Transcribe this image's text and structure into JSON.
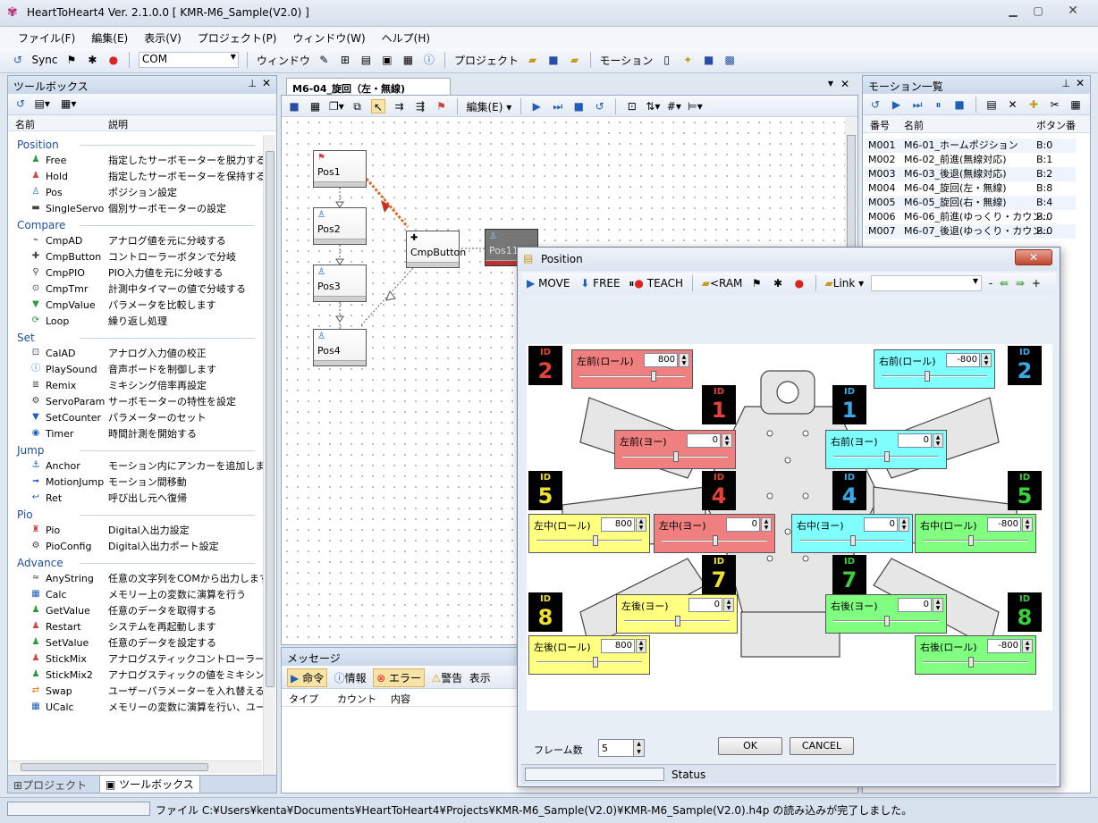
{
  "window": {
    "title": "HeartToHeart4 Ver. 2.1.0.0 [ KMR-M6_Sample(V2.0) ]"
  },
  "menu": [
    "ファイル(F)",
    "編集(E)",
    "表示(V)",
    "プロジェクト(P)",
    "ウィンドウ(W)",
    "ヘルプ(H)"
  ],
  "toolbar": {
    "sync": "Sync",
    "com_label": "COM",
    "window_label": "ウィンドウ",
    "project_label": "プロジェクト",
    "motion_label": "モーション"
  },
  "toolbox": {
    "title": "ツールボックス",
    "col_name": "名前",
    "col_desc": "説明",
    "groups": [
      {
        "name": "Position",
        "items": [
          {
            "icon": "free-icon",
            "name": "Free",
            "desc": "指定したサーボモーターを脱力する"
          },
          {
            "icon": "hold-icon",
            "name": "Hold",
            "desc": "指定したサーボモーターを保持する"
          },
          {
            "icon": "pos-icon",
            "name": "Pos",
            "desc": "ポジション設定"
          },
          {
            "icon": "singleservo-icon",
            "name": "SingleServo",
            "desc": "個別サーボモーターの設定"
          }
        ]
      },
      {
        "name": "Compare",
        "items": [
          {
            "icon": "cmpad-icon",
            "name": "CmpAD",
            "desc": "アナログ値を元に分岐する"
          },
          {
            "icon": "cmpbutton-icon",
            "name": "CmpButton",
            "desc": "コントローラーボタンで分岐"
          },
          {
            "icon": "cmppio-icon",
            "name": "CmpPIO",
            "desc": "PIO入力値を元に分岐する"
          },
          {
            "icon": "cmptmr-icon",
            "name": "CmpTmr",
            "desc": "計測中タイマーの値で分岐する"
          },
          {
            "icon": "cmpvalue-icon",
            "name": "CmpValue",
            "desc": "パラメータを比較します"
          },
          {
            "icon": "loop-icon",
            "name": "Loop",
            "desc": "繰り返し処理"
          }
        ]
      },
      {
        "name": "Set",
        "items": [
          {
            "icon": "calad-icon",
            "name": "CalAD",
            "desc": "アナログ入力値の校正"
          },
          {
            "icon": "playsound-icon",
            "name": "PlaySound",
            "desc": "音声ボードを制御します"
          },
          {
            "icon": "remix-icon",
            "name": "Remix",
            "desc": "ミキシング倍率再設定"
          },
          {
            "icon": "servoparam-icon",
            "name": "ServoParam",
            "desc": "サーボモーターの特性を設定"
          },
          {
            "icon": "setcounter-icon",
            "name": "SetCounter",
            "desc": "パラメーターのセット"
          },
          {
            "icon": "timer-icon",
            "name": "Timer",
            "desc": "時間計測を開始する"
          }
        ]
      },
      {
        "name": "Jump",
        "items": [
          {
            "icon": "anchor-icon",
            "name": "Anchor",
            "desc": "モーション内にアンカーを追加します"
          },
          {
            "icon": "motionjump-icon",
            "name": "MotionJump",
            "desc": "モーション間移動"
          },
          {
            "icon": "ret-icon",
            "name": "Ret",
            "desc": "呼び出し元へ復帰"
          }
        ]
      },
      {
        "name": "Pio",
        "items": [
          {
            "icon": "pio-icon",
            "name": "Pio",
            "desc": "Digital入出力設定"
          },
          {
            "icon": "pioconfig-icon",
            "name": "PioConfig",
            "desc": "Digital入出力ポート設定"
          }
        ]
      },
      {
        "name": "Advance",
        "items": [
          {
            "icon": "anystring-icon",
            "name": "AnyString",
            "desc": "任意の文字列をCOMから出力します"
          },
          {
            "icon": "calc-icon",
            "name": "Calc",
            "desc": "メモリー上の変数に演算を行う"
          },
          {
            "icon": "getvalue-icon",
            "name": "GetValue",
            "desc": "任意のデータを取得する"
          },
          {
            "icon": "restart-icon",
            "name": "Restart",
            "desc": "システムを再起動します"
          },
          {
            "icon": "setvalue-icon",
            "name": "SetValue",
            "desc": "任意のデータを設定する"
          },
          {
            "icon": "stickmix-icon",
            "name": "StickMix",
            "desc": "アナログスティックコントローラーの値で"
          },
          {
            "icon": "stickmix2-icon",
            "name": "StickMix2",
            "desc": "アナログスティックの値をミキシングソー"
          },
          {
            "icon": "swap-icon",
            "name": "Swap",
            "desc": "ユーザーパラメーターを入れ替える"
          },
          {
            "icon": "ucalc-icon",
            "name": "UCalc",
            "desc": "メモリーの変数に演算を行い、ユー"
          }
        ]
      }
    ],
    "tab_project": "プロジェクト",
    "tab_toolbox": "ツールボックス"
  },
  "editor": {
    "tab": "M6-04_旋回（左・無線)",
    "edit_menu": "編集(E)",
    "nodes": [
      "Pos1",
      "Pos2",
      "Pos3",
      "Pos4",
      "CmpButton",
      "Pos11"
    ]
  },
  "messages": {
    "title": "メッセージ",
    "btn_cmd": "命令",
    "btn_info": "情報",
    "btn_error": "エラー",
    "btn_warn": "警告",
    "btn_disp": "表示",
    "col_type": "タイプ",
    "col_count": "カウント",
    "col_content": "内容"
  },
  "motions": {
    "title": "モーション一覧",
    "col_no": "番号",
    "col_name": "名前",
    "col_btn": "ボタン番",
    "rows": [
      {
        "no": "M001",
        "name": "M6-01_ホームポジション",
        "btn": "B:0"
      },
      {
        "no": "M002",
        "name": "M6-02_前進(無線対応)",
        "btn": "B:1"
      },
      {
        "no": "M003",
        "name": "M6-03_後退(無線対応)",
        "btn": "B:2"
      },
      {
        "no": "M004",
        "name": "M6-04_旋回(左・無線)",
        "btn": "B:8"
      },
      {
        "no": "M005",
        "name": "M6-05_旋回(右・無線)",
        "btn": "B:4"
      },
      {
        "no": "M006",
        "name": "M6-06_前進(ゆっくり・カウン…",
        "btn": "B:0"
      },
      {
        "no": "M007",
        "name": "M6-07_後退(ゆっくり・カウン…",
        "btn": "B:0"
      }
    ]
  },
  "status": {
    "text": "ファイル C:¥Users¥kenta¥Documents¥HeartToHeart4¥Projects¥KMR-M6_Sample(V2.0)¥KMR-M6_Sample(V2.0).h4p の読み込みが完了しました。"
  },
  "dialog": {
    "title": "Position",
    "move": "MOVE",
    "free": "FREE",
    "teach": "TEACH",
    "ram": "<RAM",
    "link": "Link",
    "frame_label": "フレーム数",
    "frame_value": "5",
    "ok": "OK",
    "cancel": "CANCEL",
    "status": "Status",
    "ids": {
      "id_tag": "ID",
      "l_front_roll": "2",
      "l_front_yaw": "1",
      "r_front_yaw": "1",
      "r_front_roll": "2",
      "l_mid_roll": "5",
      "l_mid_yaw": "4",
      "r_mid_yaw": "4",
      "r_mid_roll": "5",
      "l_rear_yaw": "7",
      "r_rear_yaw": "7",
      "l_rear_roll": "8",
      "r_rear_roll": "8"
    },
    "servos": {
      "l_front_roll": {
        "label": "左前(ロール)",
        "value": "800",
        "level": 0.7
      },
      "r_front_roll": {
        "label": "右前(ロール)",
        "value": "-800",
        "level": 0.42
      },
      "l_front_yaw": {
        "label": "左前(ヨー)",
        "value": "0",
        "level": 0.5
      },
      "r_front_yaw": {
        "label": "右前(ヨー)",
        "value": "0",
        "level": 0.5
      },
      "l_mid_roll": {
        "label": "左中(ロール)",
        "value": "800",
        "level": 0.55
      },
      "l_mid_yaw": {
        "label": "左中(ヨー)",
        "value": "0",
        "level": 0.5
      },
      "r_mid_yaw": {
        "label": "右中(ヨー)",
        "value": "0",
        "level": 0.5
      },
      "r_mid_roll": {
        "label": "右中(ロール)",
        "value": "-800",
        "level": 0.45
      },
      "l_rear_yaw": {
        "label": "左後(ヨー)",
        "value": "0",
        "level": 0.5
      },
      "r_rear_yaw": {
        "label": "右後(ヨー)",
        "value": "0",
        "level": 0.5
      },
      "l_rear_roll": {
        "label": "左後(ロール)",
        "value": "800",
        "level": 0.55
      },
      "r_rear_roll": {
        "label": "右後(ロール)",
        "value": "-800",
        "level": 0.45
      }
    }
  },
  "colors": {
    "red": "#f08080",
    "yellow": "#ffff80",
    "cyan": "#80ffff",
    "green": "#80ff80"
  }
}
